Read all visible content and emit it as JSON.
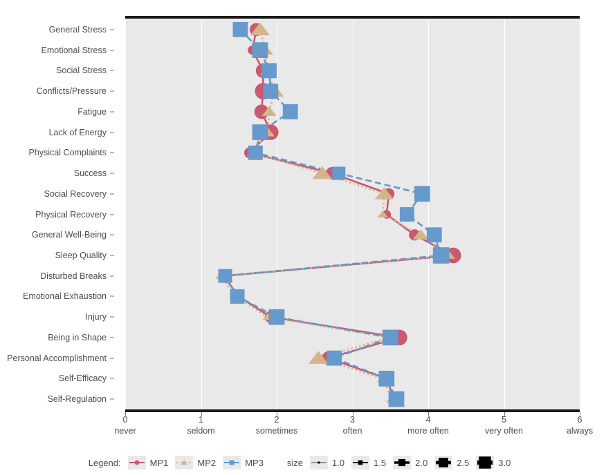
{
  "chart_data": {
    "type": "line",
    "title": "",
    "xlabel": "",
    "ylabel": "",
    "xlim": [
      0,
      6
    ],
    "grid": true,
    "legend_position": "bottom",
    "orientation": "horizontal",
    "x_ticks": [
      {
        "value": 0,
        "number": "0",
        "label": "never"
      },
      {
        "value": 1,
        "number": "1",
        "label": "seldom"
      },
      {
        "value": 2,
        "number": "2",
        "label": "sometimes"
      },
      {
        "value": 3,
        "number": "3",
        "label": "often"
      },
      {
        "value": 4,
        "number": "4",
        "label": "more often"
      },
      {
        "value": 5,
        "number": "5",
        "label": "very often"
      },
      {
        "value": 6,
        "number": "6",
        "label": "always"
      }
    ],
    "categories": [
      "General Stress",
      "Emotional Stress",
      "Social Stress",
      "Conflicts/Pressure",
      "Fatigue",
      "Lack of Energy",
      "Physical Complaints",
      "Success",
      "Social Recovery",
      "Physical Recovery",
      "General Well-Being",
      "Sleep Quality",
      "Disturbed Breaks",
      "Emotional Exhaustion",
      "Injury",
      "Being in Shape",
      "Personal Accomplishment",
      "Self-Efficacy",
      "Self-Regulation"
    ],
    "series": [
      {
        "name": "MP1",
        "color": "#c8596f",
        "shape": "circle",
        "linestyle": "solid",
        "values": [
          1.73,
          1.68,
          1.82,
          1.82,
          1.8,
          1.92,
          1.64,
          2.73,
          3.48,
          3.45,
          3.82,
          4.33,
          1.3,
          1.5,
          1.92,
          3.62,
          2.68,
          3.45,
          3.55
        ],
        "sizes": [
          2.2,
          1.6,
          2.4,
          2.7,
          2.4,
          2.6,
          1.8,
          2.1,
          1.9,
          1.5,
          1.9,
          2.6,
          1.2,
          1.2,
          2.0,
          2.6,
          2.2,
          1.5,
          1.5
        ]
      },
      {
        "name": "MP2",
        "color": "#d4b48b",
        "shape": "triangle",
        "linestyle": "dotted",
        "values": [
          1.78,
          1.85,
          1.88,
          1.97,
          1.9,
          1.88,
          1.68,
          2.6,
          3.42,
          3.4,
          3.9,
          4.28,
          1.26,
          1.46,
          1.88,
          3.48,
          2.55,
          3.4,
          3.52
        ],
        "sizes": [
          2.6,
          2.1,
          2.1,
          2.5,
          2.0,
          1.9,
          1.5,
          2.6,
          2.5,
          1.5,
          2.1,
          1.6,
          1.5,
          1.3,
          1.5,
          2.4,
          2.6,
          1.6,
          1.6
        ]
      },
      {
        "name": "MP3",
        "color": "#6699cc",
        "shape": "square",
        "linestyle": "dashed",
        "values": [
          1.52,
          1.78,
          1.9,
          1.92,
          2.18,
          1.78,
          1.72,
          2.82,
          3.92,
          3.72,
          4.08,
          4.17,
          1.32,
          1.48,
          2.0,
          3.5,
          2.76,
          3.45,
          3.58
        ],
        "sizes": [
          2.5,
          2.6,
          2.5,
          2.5,
          2.5,
          2.6,
          2.4,
          2.2,
          2.6,
          2.4,
          2.5,
          2.7,
          2.3,
          2.4,
          2.6,
          2.6,
          2.5,
          2.6,
          2.6
        ]
      }
    ],
    "size_legend": {
      "title": "size",
      "values": [
        "1.0",
        "1.5",
        "2.0",
        "2.5",
        "3.0"
      ]
    },
    "legend_title": "Legend:"
  },
  "legend": {
    "title": "Legend:",
    "entries": [
      {
        "label": "MP1",
        "color": "#c8596f"
      },
      {
        "label": "MP2",
        "color": "#d4b48b"
      },
      {
        "label": "MP3",
        "color": "#6699cc"
      }
    ],
    "size_title": "size",
    "size_values": [
      "1.0",
      "1.5",
      "2.0",
      "2.5",
      "3.0"
    ]
  },
  "colors": {
    "panel_background": "#e9e9e9",
    "grid": "#ffffff",
    "axis": "#1a1a1a",
    "text": "#4d4d4d"
  }
}
